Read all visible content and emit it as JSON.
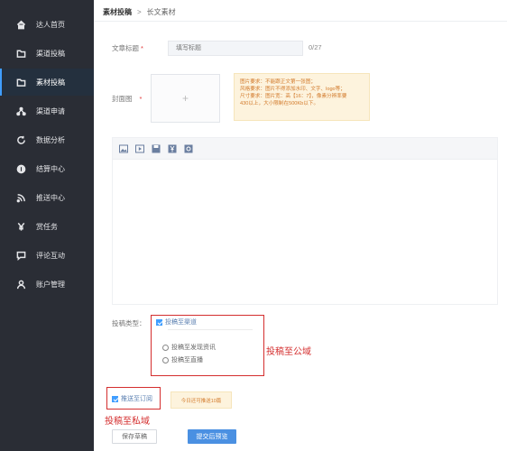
{
  "sidebar": {
    "items": [
      {
        "label": "达人首页",
        "icon": "home-icon"
      },
      {
        "label": "渠道投稿",
        "icon": "folder-icon"
      },
      {
        "label": "素材投稿",
        "icon": "folder-icon",
        "active": true
      },
      {
        "label": "渠道申请",
        "icon": "share-icon"
      },
      {
        "label": "数据分析",
        "icon": "refresh-icon"
      },
      {
        "label": "结算中心",
        "icon": "coin-icon"
      },
      {
        "label": "推送中心",
        "icon": "rss-icon"
      },
      {
        "label": "赏任务",
        "icon": "yen-icon"
      },
      {
        "label": "评论互动",
        "icon": "comment-icon"
      },
      {
        "label": "账户管理",
        "icon": "user-icon"
      }
    ]
  },
  "breadcrumb": {
    "first": "素材投稿",
    "separator": ">",
    "last": "长文素材"
  },
  "form": {
    "title_label": "文章标题",
    "title_placeholder": "填写标题",
    "title_counter": "0/27",
    "cover_label": "封面图",
    "cover_plus": "+",
    "required_mark": "*",
    "cover_tips": [
      "图片要求：不能跟正文第一张图；",
      "风格要求：图片不得添加水印、文字、logo等；",
      "尺寸要求：图片宽：高【16：7】，像素分辨率要",
      "430以上，大小限制在500Kb以下。"
    ],
    "type_label": "投稿类型：",
    "public_checkbox": "投稿至渠道",
    "radio_options": [
      "投稿至发现资讯",
      "投稿至直播"
    ],
    "private_checkbox": "推送至订阅",
    "private_tip": "今日还可推送10篇"
  },
  "annotations": {
    "public": "投稿至公域",
    "private": "投稿至私域"
  },
  "buttons": {
    "draft": "保存草稿",
    "submit": "提交后预览"
  },
  "colors": {
    "sidebar_bg": "#2a2d35",
    "accent": "#4a90e2",
    "annotation_red": "#d42e2e",
    "tip_bg": "#fdf3dd",
    "tip_text": "#d27a2b"
  }
}
